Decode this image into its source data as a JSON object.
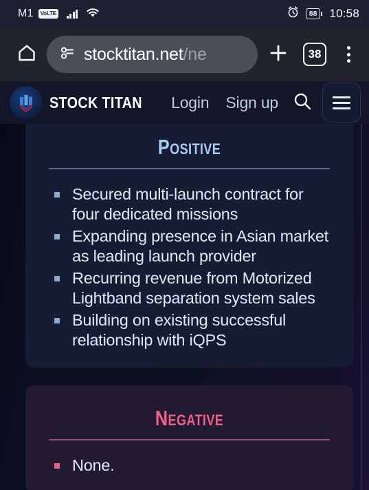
{
  "status_bar": {
    "carrier": "M1",
    "network_badge": "VoLTE",
    "signal_icon": "signal-bars-icon",
    "wifi_icon": "wifi-icon",
    "alarm_icon": "alarm-clock-icon",
    "battery_level": "88",
    "time": "10:58"
  },
  "browser_bar": {
    "home_icon": "home-icon",
    "site_settings_icon": "tune-icon",
    "url_visible": "stocktitan.net",
    "url_dim": "/ne",
    "new_tab_icon": "plus-icon",
    "tab_count": "38",
    "overflow_icon": "more-vertical-icon"
  },
  "site_header": {
    "logo_icon": "stock-titan-logo-icon",
    "brand": "STOCK TITAN",
    "login_label": "Login",
    "signup_label": "Sign up",
    "search_icon": "search-icon",
    "menu_icon": "hamburger-menu-icon"
  },
  "content": {
    "positive": {
      "title": "Positive",
      "title_color": "#a8cbf0",
      "items": [
        "Secured multi-launch contract for four dedicated missions",
        "Expanding presence in Asian market as leading launch provider",
        "Recurring revenue from Motorized Lightband separation system sales",
        "Building on existing successful relationship with iQPS"
      ]
    },
    "negative": {
      "title": "Negative",
      "title_color": "#ef5f86",
      "items": [
        "None."
      ]
    }
  }
}
